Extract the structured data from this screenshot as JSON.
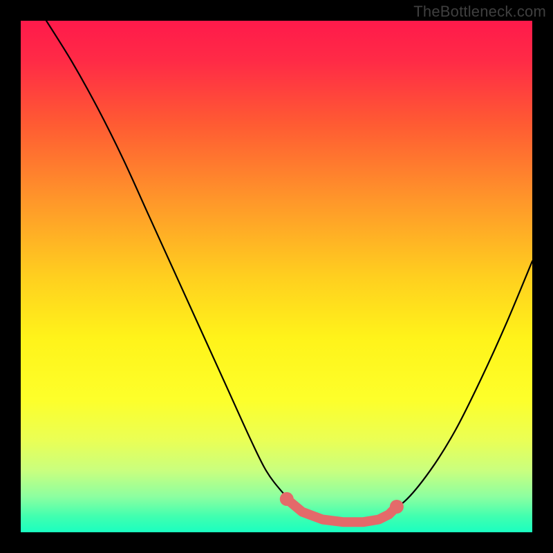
{
  "watermark": "TheBottleneck.com",
  "colors": {
    "frame": "#000000",
    "watermark": "#3f3f3f",
    "curve": "#000000",
    "marker": "#e46a6a",
    "gradient_stops": [
      {
        "offset": 0.0,
        "color": "#ff1a4b"
      },
      {
        "offset": 0.08,
        "color": "#ff2b46"
      },
      {
        "offset": 0.2,
        "color": "#ff5a33"
      },
      {
        "offset": 0.35,
        "color": "#ff962a"
      },
      {
        "offset": 0.5,
        "color": "#ffcf1f"
      },
      {
        "offset": 0.62,
        "color": "#fff31a"
      },
      {
        "offset": 0.74,
        "color": "#fdff2a"
      },
      {
        "offset": 0.82,
        "color": "#eaff55"
      },
      {
        "offset": 0.88,
        "color": "#c9ff7f"
      },
      {
        "offset": 0.93,
        "color": "#8dffa0"
      },
      {
        "offset": 0.97,
        "color": "#3fffb0"
      },
      {
        "offset": 1.0,
        "color": "#1affc0"
      }
    ]
  },
  "chart_data": {
    "type": "line",
    "title": "",
    "xlabel": "",
    "ylabel": "",
    "xlim": [
      0,
      100
    ],
    "ylim": [
      0,
      100
    ],
    "series": [
      {
        "name": "bottleneck-curve",
        "x": [
          5,
          10,
          15,
          20,
          25,
          30,
          35,
          40,
          45,
          48,
          51,
          54,
          57,
          60,
          63,
          66,
          70,
          75,
          80,
          85,
          90,
          95,
          100
        ],
        "y": [
          100,
          92,
          83,
          73,
          62,
          51,
          40,
          29,
          18,
          12,
          8,
          5,
          3,
          2,
          2,
          2,
          3,
          6,
          12,
          20,
          30,
          41,
          53
        ]
      }
    ],
    "optimal_markers": {
      "name": "optimal-range",
      "x": [
        52,
        55,
        59,
        63,
        67,
        70,
        72,
        73.5
      ],
      "y": [
        6.5,
        4,
        2.5,
        2,
        2,
        2.5,
        3.5,
        5
      ]
    },
    "optimal_dots": {
      "name": "optimal-endpoints",
      "x": [
        52,
        73.5
      ],
      "y": [
        6.5,
        5
      ]
    }
  }
}
